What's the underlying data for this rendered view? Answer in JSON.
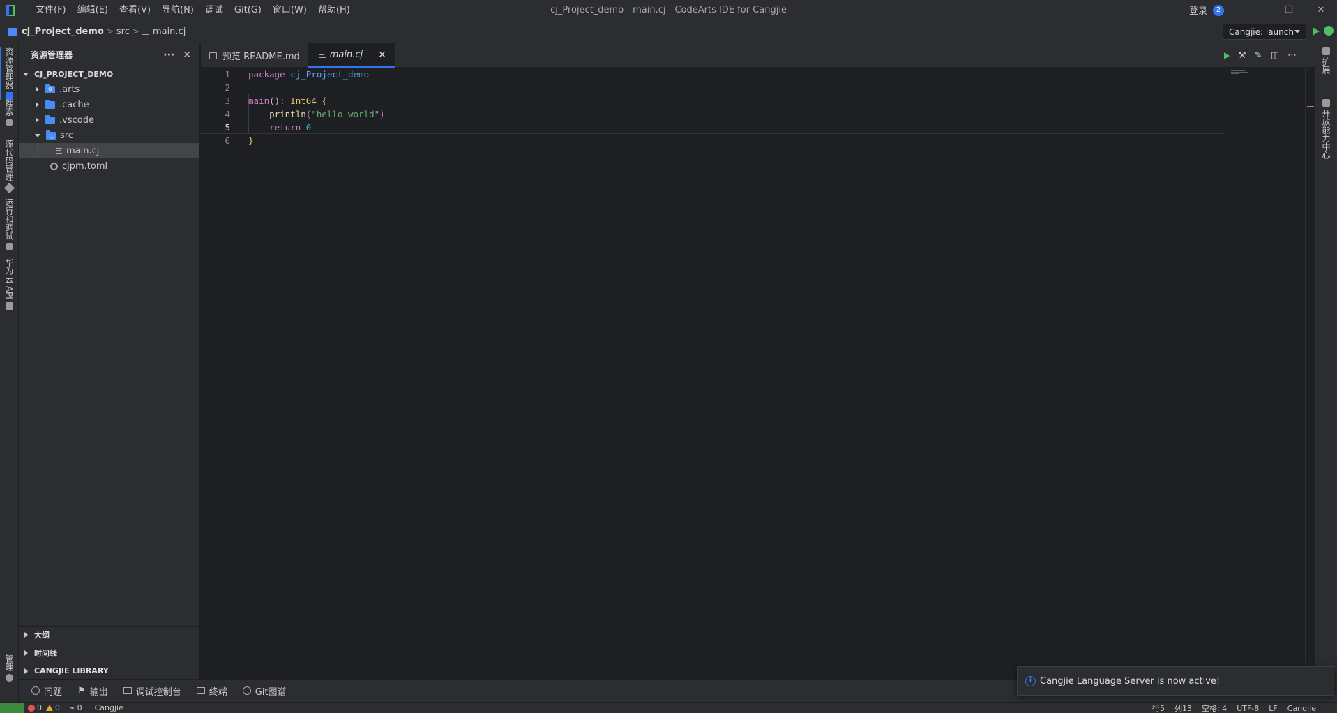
{
  "window": {
    "title": "cj_Project_demo - main.cj - CodeArts IDE for Cangjie",
    "login": "登录",
    "notification_count": "2",
    "minimize": "—",
    "restore": "❐",
    "close": "✕"
  },
  "menu": [
    {
      "label": "文件(F)"
    },
    {
      "label": "编辑(E)"
    },
    {
      "label": "查看(V)"
    },
    {
      "label": "导航(N)"
    },
    {
      "label": "调试"
    },
    {
      "label": "Git(G)"
    },
    {
      "label": "窗口(W)"
    },
    {
      "label": "帮助(H)"
    }
  ],
  "breadcrumb": {
    "project": "cj_Project_demo",
    "folder": "src",
    "file": "main.cj",
    "sep": ">"
  },
  "run_config": {
    "label": "Cangjie: launch"
  },
  "activity_left": [
    {
      "label": "资源管理器",
      "icon": "explorer-icon"
    },
    {
      "label": "搜索",
      "icon": "search-icon"
    },
    {
      "label": "源代码管理",
      "icon": "source-control-icon"
    },
    {
      "label": "运行和调试",
      "icon": "debug-icon"
    },
    {
      "label": "华为云 API",
      "icon": "api-icon"
    },
    {
      "label": "管理",
      "icon": "gear-icon"
    }
  ],
  "activity_right": [
    {
      "label": "扩展"
    },
    {
      "label": "开放能力中心"
    }
  ],
  "sidebar": {
    "title": "资源管理器",
    "more": "···",
    "close": "✕",
    "root": "CJ_PROJECT_DEMO",
    "tree": [
      {
        "name": ".arts"
      },
      {
        "name": ".cache"
      },
      {
        "name": ".vscode"
      },
      {
        "name": "src"
      },
      {
        "name": "main.cj"
      },
      {
        "name": "cjpm.toml"
      }
    ],
    "sections": [
      {
        "label": "大纲"
      },
      {
        "label": "时间线"
      },
      {
        "label": "CANGJIE LIBRARY"
      }
    ]
  },
  "tabs": [
    {
      "label": "预览 README.md"
    },
    {
      "label": "main.cj",
      "close": "✕"
    }
  ],
  "editor": {
    "line_numbers": [
      "1",
      "2",
      "3",
      "4",
      "5",
      "6"
    ],
    "lines": {
      "l1_kw": "package",
      "l1_name": "cj_Project_demo",
      "l3_fn": "main",
      "l3_paren": "():",
      "l3_type": "Int64",
      "l3_brace": "{",
      "l4_fn": "println",
      "l4_open": "(",
      "l4_str": "\"hello world\"",
      "l4_close": ")",
      "l5_kw": "return",
      "l5_num": "0",
      "l6_brace": "}"
    }
  },
  "panel_tabs": [
    {
      "label": "问题"
    },
    {
      "label": "输出"
    },
    {
      "label": "调试控制台"
    },
    {
      "label": "终端"
    },
    {
      "label": "Git图谱"
    }
  ],
  "status": {
    "errors": "0",
    "warnings": "0",
    "ports": "0",
    "language_left": "Cangjie",
    "line": "行5",
    "col": "列13",
    "spaces": "空格: 4",
    "encoding": "UTF-8",
    "eol": "LF",
    "language": "Cangjie"
  },
  "notification": {
    "message": "Cangjie Language Server is now active!"
  },
  "colors": {
    "accent": "#3574f0",
    "run_green": "#4fbf6a",
    "folder_blue": "#4a8cf7"
  }
}
